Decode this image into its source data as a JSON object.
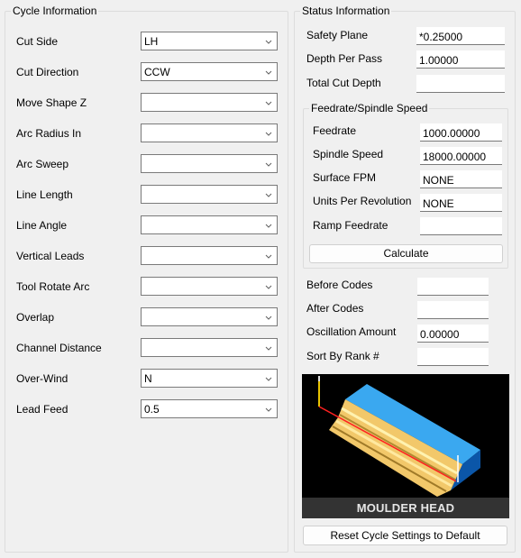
{
  "cycle_info": {
    "title": "Cycle Information",
    "fields": [
      {
        "label": "Cut Side",
        "value": "LH"
      },
      {
        "label": "Cut Direction",
        "value": "CCW"
      },
      {
        "label": "Move Shape Z",
        "value": ""
      },
      {
        "label": "Arc Radius In",
        "value": ""
      },
      {
        "label": "Arc Sweep",
        "value": ""
      },
      {
        "label": "Line Length",
        "value": ""
      },
      {
        "label": "Line Angle",
        "value": ""
      },
      {
        "label": "Vertical Leads",
        "value": ""
      },
      {
        "label": "Tool Rotate Arc",
        "value": ""
      },
      {
        "label": "Overlap",
        "value": ""
      },
      {
        "label": "Channel Distance",
        "value": ""
      },
      {
        "label": "Over-Wind",
        "value": "N"
      },
      {
        "label": "Lead Feed",
        "value": "0.5"
      }
    ]
  },
  "status_info": {
    "title": "Status Information",
    "fields": [
      {
        "label": "Safety Plane",
        "value": "*0.25000"
      },
      {
        "label": "Depth Per Pass",
        "value": "1.00000"
      },
      {
        "label": "Total Cut Depth",
        "value": ""
      }
    ],
    "feedrate_group": {
      "title": "Feedrate/Spindle Speed",
      "fields": [
        {
          "label": "Feedrate",
          "value": "1000.00000"
        },
        {
          "label": "Spindle Speed",
          "value": "18000.00000"
        },
        {
          "label": "Surface FPM",
          "value": "NONE"
        },
        {
          "label": "Units Per Revolution",
          "value": "NONE"
        },
        {
          "label": "Ramp Feedrate",
          "value": ""
        }
      ],
      "calculate_label": "Calculate"
    },
    "extra_fields": [
      {
        "label": "Before Codes",
        "value": ""
      },
      {
        "label": "After Codes",
        "value": ""
      },
      {
        "label": "Oscillation Amount",
        "value": "0.00000"
      },
      {
        "label": "Sort By Rank #",
        "value": ""
      }
    ],
    "preview": {
      "caption": "MOULDER HEAD",
      "colors": {
        "background": "#000000",
        "stock_top": "#3aa8f0",
        "stock_side": "#0b56a8",
        "profile": "#f5cf7a",
        "toolpath": "#ff2020",
        "tool": "#e8c400"
      }
    },
    "reset_label": "Reset Cycle Settings to Default"
  }
}
